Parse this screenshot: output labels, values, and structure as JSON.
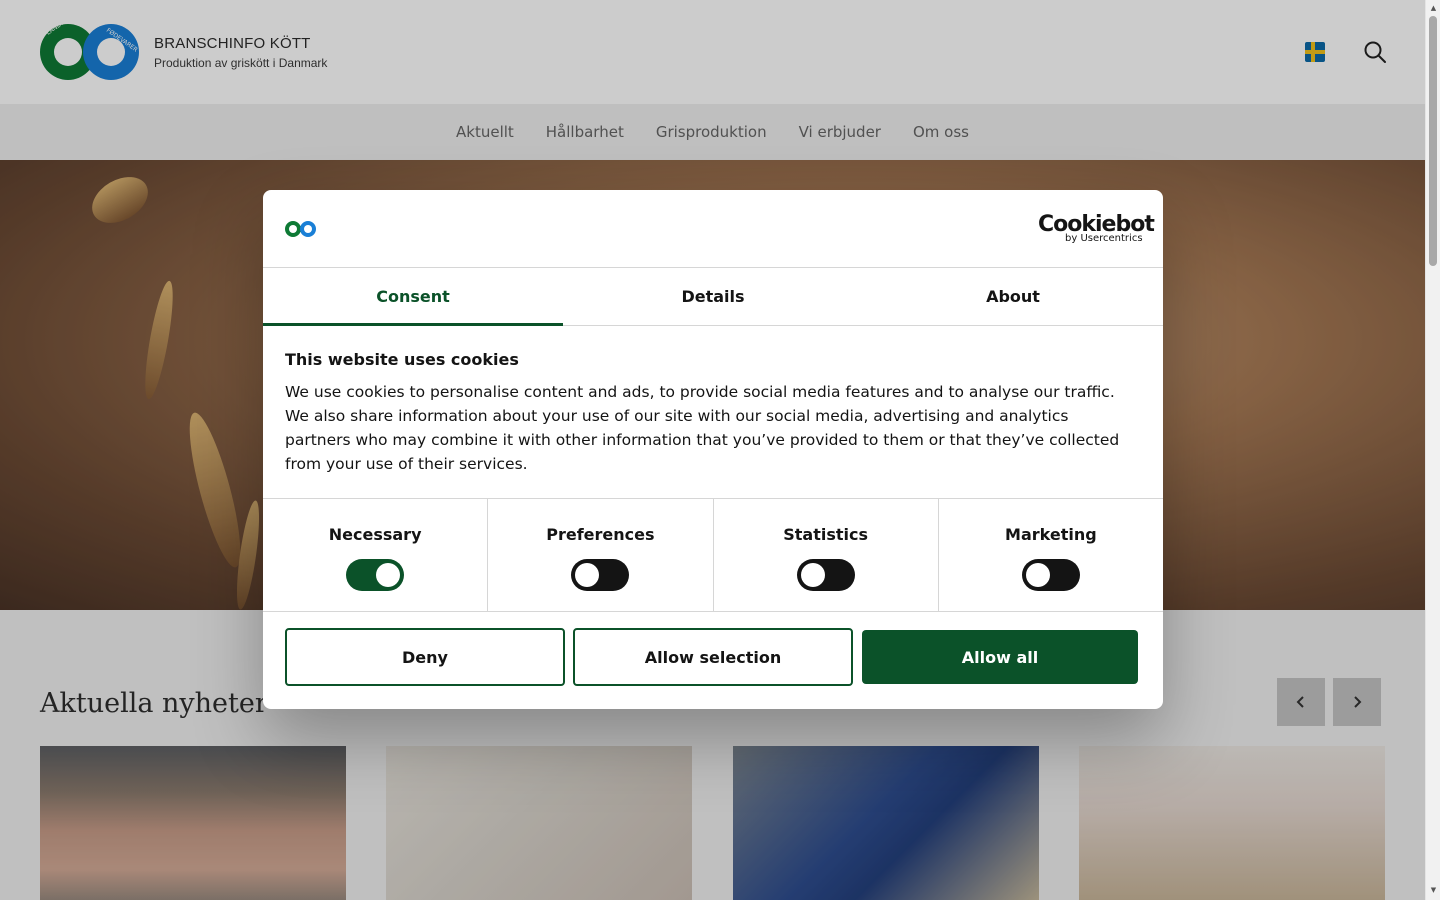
{
  "header": {
    "brand_title": "BRANSCHINFO KÖTT",
    "brand_subtitle": "Produktion av griskött i Danmark",
    "logo_text": "LANDBRUG FØDEVARER",
    "language_flag": "sweden-flag-icon",
    "search_icon": "search-icon"
  },
  "nav": {
    "items": [
      {
        "label": "Aktuellt"
      },
      {
        "label": "Hållbarhet"
      },
      {
        "label": "Grisproduktion"
      },
      {
        "label": "Vi erbjuder"
      },
      {
        "label": "Om oss"
      }
    ]
  },
  "news": {
    "title": "Aktuella nyheter",
    "prev_icon": "chevron-left-icon",
    "next_icon": "chevron-right-icon",
    "cards": [
      "card-image-carcasses",
      "card-image-pig",
      "card-image-feed",
      "card-image-piglets"
    ]
  },
  "cookie_dialog": {
    "brand": "Cookiebot",
    "brand_by": "by Usercentrics",
    "tabs": [
      {
        "label": "Consent",
        "active": true
      },
      {
        "label": "Details",
        "active": false
      },
      {
        "label": "About",
        "active": false
      }
    ],
    "heading": "This website uses cookies",
    "body": "We use cookies to personalise content and ads, to provide social media features and to analyse our traffic. We also share information about your use of our site with our social media, advertising and analytics partners who may combine it with other information that you’ve provided to them or that they’ve collected from your use of their services.",
    "toggles": [
      {
        "label": "Necessary",
        "on": true
      },
      {
        "label": "Preferences",
        "on": false
      },
      {
        "label": "Statistics",
        "on": false
      },
      {
        "label": "Marketing",
        "on": false
      }
    ],
    "buttons": {
      "deny": "Deny",
      "allow_selection": "Allow selection",
      "allow_all": "Allow all"
    }
  },
  "colors": {
    "accent_green": "#0b5229",
    "logo_green": "#0e7a35",
    "logo_blue": "#1a7fd6",
    "nav_bg": "#efefef"
  }
}
